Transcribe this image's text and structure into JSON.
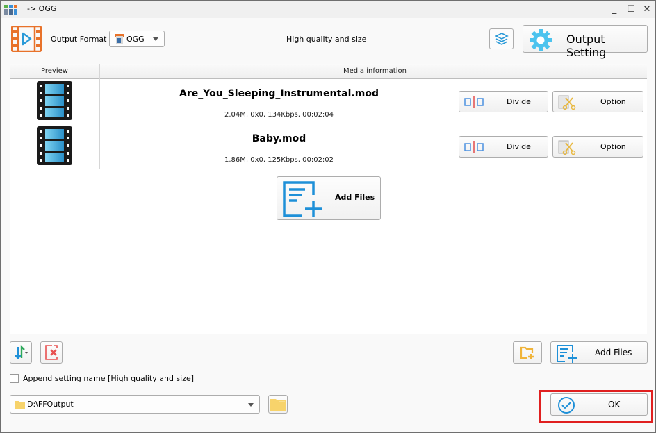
{
  "window": {
    "title": "-> OGG",
    "controls": {
      "minimize": "_",
      "maximize": "☐",
      "close": "✕"
    }
  },
  "toolbar": {
    "output_format_label": "Output Format",
    "format_value": "OGG",
    "quality_text": "High quality and size",
    "output_setting_label": "Output Setting"
  },
  "table": {
    "headers": [
      "Preview",
      "Media information"
    ],
    "rows": [
      {
        "name": "Are_You_Sleeping_Instrumental.mod",
        "info": "2.04M, 0x0, 134Kbps, 00:02:04",
        "divide_label": "Divide",
        "option_label": "Option"
      },
      {
        "name": "Baby.mod",
        "info": "1.86M, 0x0, 125Kbps, 00:02:02",
        "divide_label": "Divide",
        "option_label": "Option"
      }
    ],
    "add_files_label": "Add Files"
  },
  "bottom": {
    "append_checkbox_label": "Append setting name [High quality and size]",
    "append_checked": false,
    "output_path": "D:\\FFOutput",
    "add_files_label": "Add Files",
    "ok_label": "OK"
  },
  "colors": {
    "accent_blue": "#1e90d8",
    "format_orange": "#e8722a",
    "highlight_red": "#e02020",
    "folder_yellow": "#f7d36b"
  }
}
